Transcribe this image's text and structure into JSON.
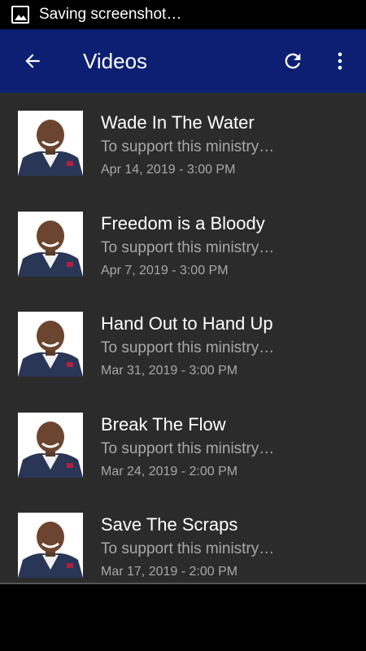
{
  "status_bar": {
    "notification_text": "Saving screenshot…"
  },
  "app_bar": {
    "title": "Videos"
  },
  "videos": [
    {
      "title": "Wade In The Water",
      "description": "To support this ministry…",
      "date": "Apr 14, 2019 - 3:00 PM"
    },
    {
      "title": "Freedom is a Bloody",
      "description": "To support this ministry…",
      "date": "Apr 7, 2019 - 3:00 PM"
    },
    {
      "title": "Hand Out to Hand Up",
      "description": "To support this ministry…",
      "date": "Mar 31, 2019 - 3:00 PM"
    },
    {
      "title": "Break The Flow",
      "description": "To support this ministry…",
      "date": "Mar 24, 2019 - 2:00 PM"
    },
    {
      "title": "Save The Scraps",
      "description": "To support this ministry…",
      "date": "Mar 17, 2019 - 2:00 PM"
    }
  ],
  "colors": {
    "app_bar": "#0d1f73",
    "list_bg": "#2b2b2b",
    "text_primary": "#ffffff",
    "text_secondary": "#a8a8a8"
  },
  "icons": {
    "status": "image-icon",
    "back": "arrow-back-icon",
    "refresh": "refresh-icon",
    "more": "more-vert-icon"
  }
}
